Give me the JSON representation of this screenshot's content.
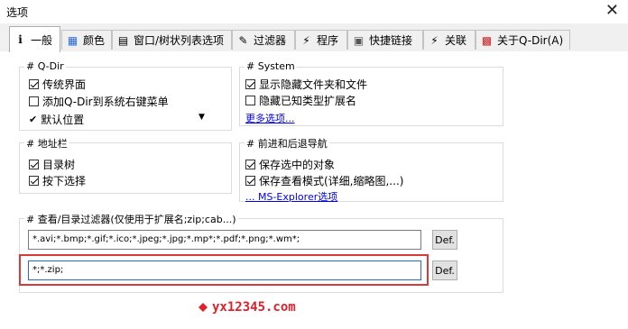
{
  "window": {
    "title": "选项",
    "close_glyph": "✕"
  },
  "tabs": [
    {
      "label": "一般",
      "icon": "info-icon",
      "glyph": "i"
    },
    {
      "label": "颜色",
      "icon": "palette-icon",
      "glyph": "▦"
    },
    {
      "label": "窗口/树状列表选项",
      "icon": "window-icon",
      "glyph": "▤"
    },
    {
      "label": "过滤器",
      "icon": "filter-icon",
      "glyph": "✎"
    },
    {
      "label": "程序",
      "icon": "program-icon",
      "glyph": "⚡"
    },
    {
      "label": "快捷链接",
      "icon": "shortcut-icon",
      "glyph": "▣"
    },
    {
      "label": "关联",
      "icon": "link-icon",
      "glyph": "⚡"
    },
    {
      "label": "关于Q-Dir(A)",
      "icon": "about-icon",
      "glyph": "▩"
    }
  ],
  "groups": {
    "qdir": {
      "label": "# Q-Dir",
      "classic_ui": {
        "label": "传统界面",
        "checked": true
      },
      "add_context_menu": {
        "label": "添加Q-Dir到系统右键菜单",
        "checked": false
      },
      "default_position": {
        "label": "默认位置",
        "check_glyph": "✔",
        "arrow_glyph": "▼"
      }
    },
    "system": {
      "label": "# System",
      "show_hidden": {
        "label": "显示隐藏文件夹和文件",
        "checked": true
      },
      "hide_ext": {
        "label": "隐藏已知类型扩展名",
        "checked": false
      },
      "more_link": "更多选项..."
    },
    "address": {
      "label": "# 地址栏",
      "tree": {
        "label": "目录树",
        "checked": true
      },
      "dropdown": {
        "label": "按下选择",
        "checked": true
      }
    },
    "nav": {
      "label": "# 前进和后退导航",
      "save_selected": {
        "label": "保存选中的对象",
        "checked": true
      },
      "save_view": {
        "label": "保存查看模式(详细,缩略图,...)",
        "checked": true
      },
      "explorer_link": "... MS-Explorer选项"
    },
    "filter": {
      "label": "# 查看/目录过滤器(仅使用于扩展名;zip;cab...)",
      "field1_value": "*.avi;*.bmp;*.gif;*.ico;*.jpeg;*.jpg;*.mp*;*.pdf;*.png;*.wm*;",
      "field2_value": "*;*.zip;",
      "def_label": "Def."
    }
  },
  "watermark": "yx12345.com",
  "colors": {
    "highlight": "#d63a3a",
    "link": "#0000ee",
    "watermark": "#e0202a"
  }
}
